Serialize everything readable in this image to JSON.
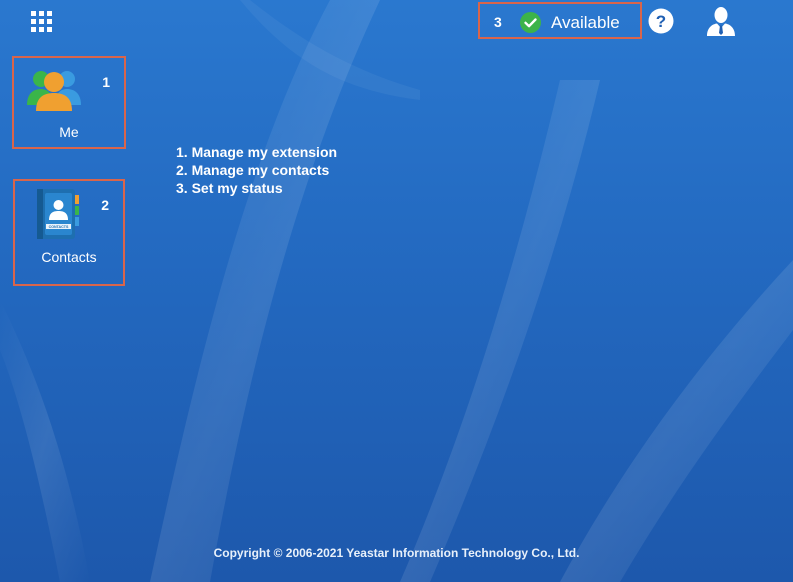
{
  "header": {
    "apps_icon": "grid-icon",
    "status": {
      "badge_number": "3",
      "label": "Available",
      "icon": "check-circle-icon",
      "icon_color": "#3cb34a"
    },
    "help_icon": "help-icon",
    "user_icon": "user-profile-icon"
  },
  "tiles": [
    {
      "badge_number": "1",
      "label": "Me",
      "icon": "people-icon"
    },
    {
      "badge_number": "2",
      "label": "Contacts",
      "icon": "contacts-book-icon"
    }
  ],
  "instructions": [
    "1. Manage my extension",
    "2. Manage my contacts",
    "3. Set my status"
  ],
  "footer": {
    "copyright": "Copyright © 2006-2021 Yeastar Information Technology Co., Ltd."
  },
  "colors": {
    "background": "#2369c0",
    "highlight_border": "#d9654b"
  }
}
